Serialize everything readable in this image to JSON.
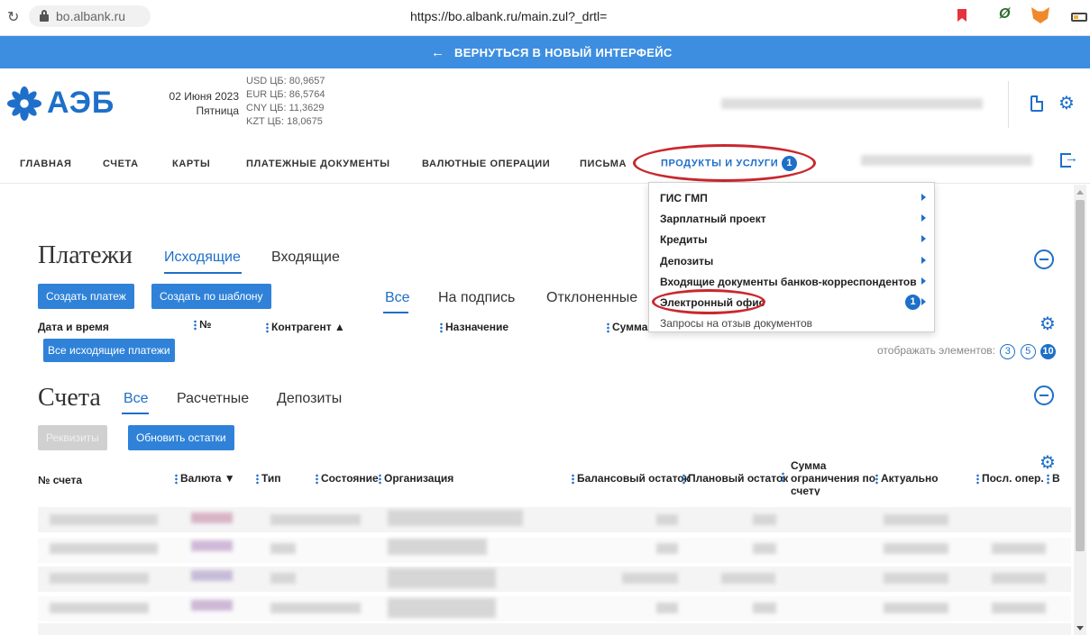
{
  "browser": {
    "reload_icon": "reload-icon",
    "hostname": "bo.albank.ru",
    "url": "https://bo.albank.ru/main.zul?_drtl="
  },
  "banner": {
    "arrow": "←",
    "text": "ВЕРНУТЬСЯ В НОВЫЙ ИНТЕРФЕЙС",
    "color": "#3d8ee0"
  },
  "header": {
    "logo_text": "АЭБ",
    "date": "02 Июня 2023",
    "weekday": "Пятница",
    "rates": [
      "USD ЦБ: 80,9657",
      "EUR ЦБ: 86,5764",
      "CNY ЦБ: 11,3629",
      "KZT ЦБ: 18,0675"
    ]
  },
  "nav": {
    "items": [
      "ГЛАВНАЯ",
      "СЧЕТА",
      "КАРТЫ",
      "ПЛАТЕЖНЫЕ ДОКУМЕНТЫ",
      "ВАЛЮТНЫЕ ОПЕРАЦИИ",
      "ПИСЬМА"
    ],
    "products_label": "ПРОДУКТЫ И УСЛУГИ",
    "products_badge": "1"
  },
  "dropdown": {
    "items": [
      "ГИС ГМП",
      "Зарплатный проект",
      "Кредиты",
      "Депозиты",
      "Входящие документы банков-корреспондентов",
      "Электронный офис",
      "Запросы на отзыв документов"
    ],
    "office_badge": "1"
  },
  "payments": {
    "title": "Платежи",
    "tabs": [
      "Исходящие",
      "Входящие"
    ],
    "create_button": "Создать платеж",
    "template_button": "Создать по шаблону",
    "filters": [
      "Все",
      "На подпись",
      "Отклоненные"
    ],
    "columns": [
      "Дата и время",
      "№",
      "Контрагент ▲",
      "Назначение",
      "Сумма, Р"
    ],
    "all_button": "Все исходящие платежи",
    "page_size_label": "отображать элементов:",
    "page_sizes": [
      "3",
      "5",
      "10"
    ]
  },
  "accounts": {
    "title": "Счета",
    "tabs": [
      "Все",
      "Расчетные",
      "Депозиты"
    ],
    "details_button": "Реквизиты",
    "refresh_button": "Обновить остатки",
    "columns": [
      "№ счета",
      "Валюта ▼",
      "Тип",
      "Состояние",
      "Организация",
      "Балансовый остаток",
      "Плановый остаток",
      "Сумма ограничения по счету",
      "Актуально",
      "Посл. опер.",
      "В"
    ]
  },
  "colors": {
    "accent": "#1e6fc9",
    "highlight": "#c8282e"
  }
}
